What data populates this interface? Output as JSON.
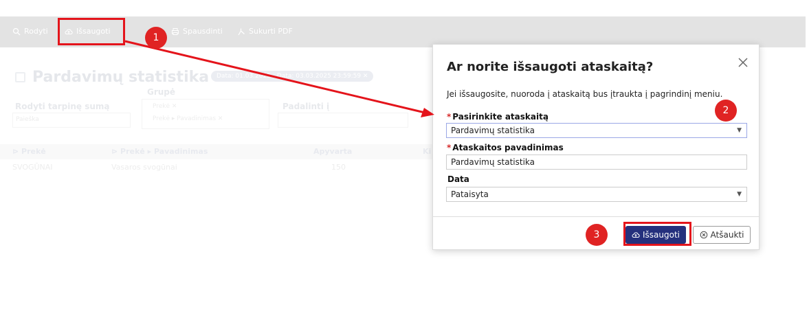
{
  "toolbar": {
    "items": [
      "Rodyti",
      "Išsaugoti",
      "Spausdinti",
      "Sukurti PDF"
    ]
  },
  "page": {
    "title": "Pardavimų statistika",
    "chip": "Data: 01.03.2025 - Data: 03.03.2025 23:59:59 ✕"
  },
  "filters": {
    "subtotal_label": "Rodyti tarpinę sumą",
    "subtotal_placeholder": "Paieška",
    "group_label": "Grupė",
    "group_tags": [
      "Prekė ✕",
      "Prekė ▸ Pavadinimas ✕"
    ],
    "split_label": "Padalinti į"
  },
  "grid": {
    "columns": [
      "⊳ Prekė",
      "⊳ Prekė ▸ Pavadinimas",
      "Apyvarta",
      "Ki"
    ],
    "row": [
      "SVOGŪNAI",
      "Vasaros svogūnai",
      "150"
    ]
  },
  "modal": {
    "title": "Ar norite išsaugoti ataskaitą?",
    "description": "Jei išsaugosite, nuoroda į ataskaitą bus įtraukta į pagrindinį meniu.",
    "required_mark": "*",
    "report_label": "Pasirinkite ataskaitą",
    "report_value": "Pardavimų statistika",
    "name_label": "Ataskaitos pavadinimas",
    "name_value": "Pardavimų statistika",
    "date_label": "Data",
    "date_value": "Pataisyta",
    "save_button": "Išsaugoti",
    "cancel_button": "Atšaukti"
  },
  "annotations": {
    "badges": [
      "1",
      "2",
      "3"
    ],
    "color": "#e02323"
  }
}
